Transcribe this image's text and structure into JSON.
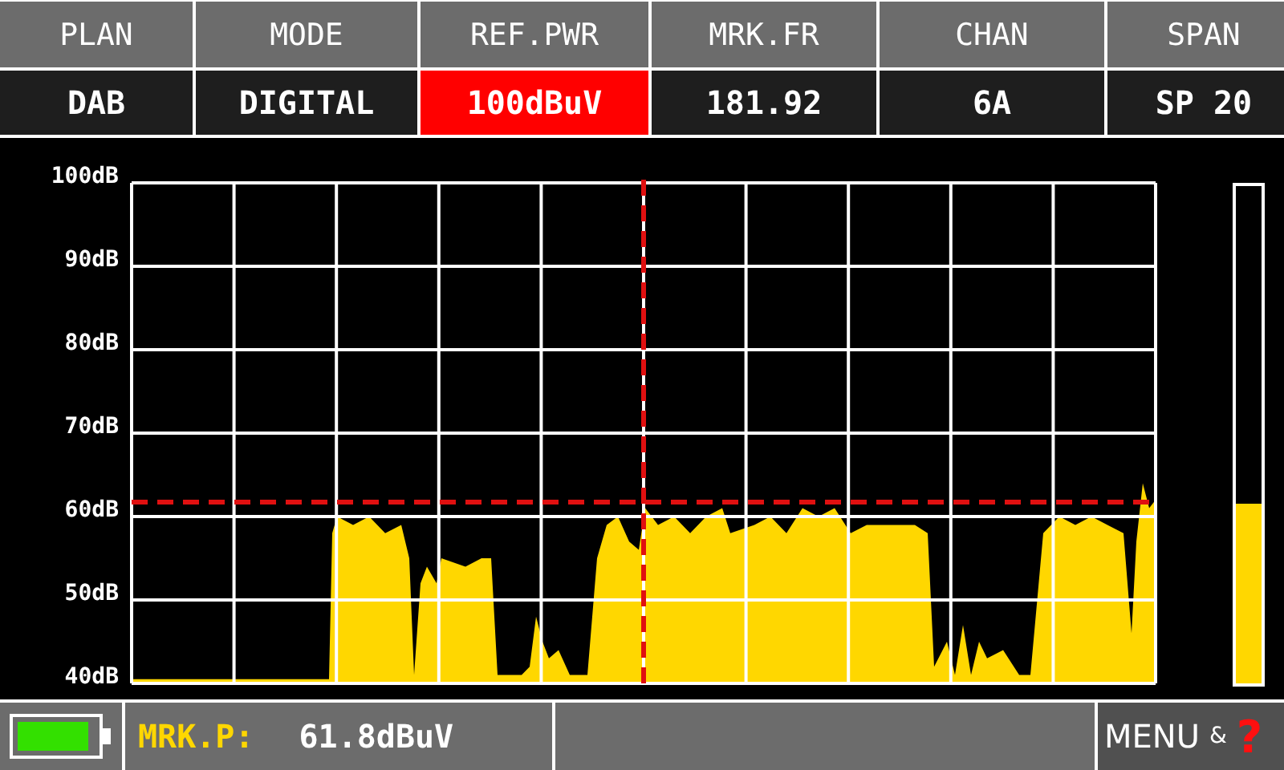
{
  "params": [
    {
      "label": "PLAN",
      "value": "DAB",
      "selected": false
    },
    {
      "label": "MODE",
      "value": "DIGITAL",
      "selected": false
    },
    {
      "label": "REF.PWR",
      "value": "100dBuV",
      "selected": true
    },
    {
      "label": "MRK.FR",
      "value": "181.92",
      "selected": false
    },
    {
      "label": "CHAN",
      "value": "6A",
      "selected": false
    },
    {
      "label": "SPAN",
      "value": "SP 20",
      "selected": false
    }
  ],
  "chart": {
    "y_labels": [
      "100dB",
      "90dB",
      "80dB",
      "70dB",
      "60dB",
      "50dB",
      "40dB"
    ]
  },
  "meter": {
    "level": 0.36
  },
  "status": {
    "marker_label": "MRK.P:",
    "marker_value": "61.8dBuV"
  },
  "menu": {
    "label": "MENU",
    "joiner": "&",
    "help": "?"
  }
}
